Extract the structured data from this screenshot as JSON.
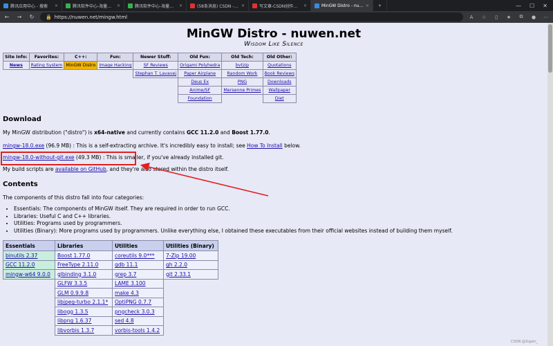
{
  "tabs": [
    {
      "label": "腾讯应用中心 - 搜索",
      "color": "#3d8bd8"
    },
    {
      "label": "腾讯软件中心-海量软件高速下载",
      "color": "#37b24d"
    },
    {
      "label": "腾讯软件中心-海量软件高速下载",
      "color": "#37b24d"
    },
    {
      "label": "(58条消息) CSDN - 专业开发者社区",
      "color": "#e03131"
    },
    {
      "label": "写文章-CSDN创作中心",
      "color": "#e03131"
    },
    {
      "label": "MinGW Distro - nuwen.net",
      "color": "#3d8bd8"
    }
  ],
  "address": {
    "url": "https://nuwen.net/mingw.html",
    "lock": "🔒"
  },
  "title": "MinGW Distro - nuwen.net",
  "subtitle": "Wisdom Like Silence",
  "nav": {
    "headers": [
      "Site Info:",
      "Favorites:",
      "C++:",
      "Fun:",
      "Newer Stuff:",
      "Old Fun:",
      "Old Tech:",
      "Old Other:"
    ],
    "rows": [
      [
        "News",
        "Rating System",
        "MinGW Distro",
        "Image Hacking",
        "SF Reviews",
        "Origami Polyhedra",
        "bvtzip",
        "Quotations"
      ],
      [
        "",
        "",
        "",
        "",
        "Stephan T. Lavavej",
        "Paper Airplane",
        "Random Work",
        "Book Reviews"
      ],
      [
        "",
        "",
        "",
        "",
        "",
        "Deus Ex",
        "PNG",
        "Downloads"
      ],
      [
        "",
        "",
        "",
        "",
        "",
        "Anime/SF",
        "Mersenne Primes",
        "Wallpaper"
      ],
      [
        "",
        "",
        "",
        "",
        "",
        "Foundation",
        "",
        "Diet"
      ]
    ]
  },
  "download": {
    "heading": "Download",
    "intro_pre": "My MinGW distribution (\"distro\") is ",
    "intro_bold1": "x64-native",
    "intro_mid": " and currently contains ",
    "intro_bold2": "GCC 11.2.0",
    "intro_and": " and ",
    "intro_bold3": "Boost 1.77.0",
    "intro_end": ".",
    "exe_link": "mingw-18.0.exe",
    "exe_text": " (96.9 MB) : This is a self-extracting archive. It's incredibly easy to install; see ",
    "howto_link": "How To Install",
    "exe_end": " below.",
    "nogit_link": "mingw-18.0-without-git.exe",
    "nogit_text": " (49.3 MB) : This is smaller, if you've already installed git.",
    "scripts_pre": "My build scripts are ",
    "scripts_link": "available on GitHub",
    "scripts_end": ", and they're also stored within the distro itself."
  },
  "contents": {
    "heading": "Contents",
    "intro": "The components of this distro fall into four categories:",
    "items": [
      "Essentials: The components of MinGW itself. They are required in order to run GCC.",
      "Libraries: Useful C and C++ libraries.",
      "Utilities: Programs used by programmers.",
      "Utilities (Binary): More programs used by programmers. Unlike everything else, I obtained these executables from their official websites instead of building them myself."
    ]
  },
  "packages": {
    "headers": [
      "Essentials",
      "Libraries",
      "Utilities",
      "Utilities (Binary)"
    ],
    "rows": [
      [
        "binutils 2.37",
        "Boost 1.77.0",
        "coreutils 9.0***",
        "7-Zip 19.00"
      ],
      [
        "GCC 11.2.0",
        "FreeType 2.11.0",
        "gdb 11.1",
        "gh 2.2.0"
      ],
      [
        "mingw-w64 9.0.0",
        "glbinding 3.1.0",
        "grep 3.7",
        "git 2.33.1"
      ],
      [
        "",
        "GLFW 3.3.5",
        "LAME 3.100",
        ""
      ],
      [
        "",
        "GLM 0.9.9.8",
        "make 4.3",
        ""
      ],
      [
        "",
        "libjpeg-turbo 2.1.1*",
        "OptiPNG 0.7.7",
        ""
      ],
      [
        "",
        "libogg 1.3.5",
        "pngcheck 3.0.3",
        ""
      ],
      [
        "",
        "libpng 1.6.37",
        "sed 4.8",
        ""
      ],
      [
        "",
        "libvorbis 1.3.7",
        "vorbis-tools 1.4.2",
        ""
      ]
    ]
  },
  "watermark": "CSDN @Xigain_",
  "colors": {
    "annotation": "#e02020",
    "selected_nav": "#f0b400",
    "link": "#1a0dab"
  }
}
